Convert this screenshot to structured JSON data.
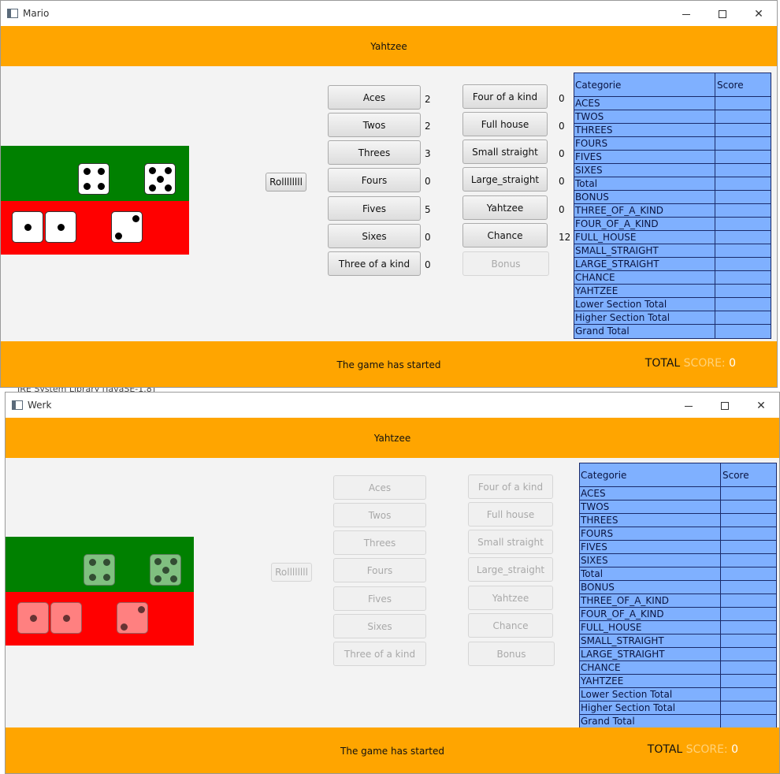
{
  "background": {
    "partial_text": "JRE System Library [JavaSE-1.8]"
  },
  "windows": [
    {
      "title": "Mario",
      "header": "Yahtzee",
      "roll_label": "Rollllllll",
      "status": "The game has started",
      "total_score": {
        "label_a": "TOTAL ",
        "label_b": "SCORE:",
        "value": " 0"
      },
      "left_buttons": [
        {
          "label": "Aces",
          "value": "2"
        },
        {
          "label": "Twos",
          "value": "2"
        },
        {
          "label": "Threes",
          "value": "3"
        },
        {
          "label": "Fours",
          "value": "0"
        },
        {
          "label": "Fives",
          "value": "5"
        },
        {
          "label": "Sixes",
          "value": "0"
        },
        {
          "label": "Three of a kind",
          "value": "0"
        }
      ],
      "right_buttons": [
        {
          "label": "Four of a kind",
          "value": "0"
        },
        {
          "label": "Full house",
          "value": "0"
        },
        {
          "label": "Small straight",
          "value": "0"
        },
        {
          "label": "Large_straight",
          "value": "0"
        },
        {
          "label": "Yahtzee",
          "value": "0"
        },
        {
          "label": "Chance",
          "value": "12"
        },
        {
          "label": "Bonus",
          "value": ""
        }
      ],
      "dice_green": [
        4,
        5
      ],
      "dice_red": [
        1,
        1,
        2
      ]
    },
    {
      "title": "Werk",
      "header": "Yahtzee",
      "roll_label": "Rollllllll",
      "status": "The game has started",
      "total_score": {
        "label_a": "TOTAL ",
        "label_b": "SCORE:",
        "value": " 0"
      },
      "left_buttons": [
        {
          "label": "Aces"
        },
        {
          "label": "Twos"
        },
        {
          "label": "Threes"
        },
        {
          "label": "Fours"
        },
        {
          "label": "Fives"
        },
        {
          "label": "Sixes"
        },
        {
          "label": "Three of a kind"
        }
      ],
      "right_buttons": [
        {
          "label": "Four of a kind"
        },
        {
          "label": "Full house"
        },
        {
          "label": "Small straight"
        },
        {
          "label": "Large_straight"
        },
        {
          "label": "Yahtzee"
        },
        {
          "label": "Chance"
        },
        {
          "label": "Bonus"
        }
      ],
      "dice_green": [
        4,
        5
      ],
      "dice_red": [
        1,
        1,
        2
      ]
    }
  ],
  "score_table": {
    "header_category": "Categorie",
    "header_score": "Score",
    "rows": [
      "ACES",
      "TWOS",
      "THREES",
      "FOURS",
      "FIVES",
      "SIXES",
      "Total",
      "BONUS",
      "THREE_OF_A_KIND",
      "FOUR_OF_A_KIND",
      "FULL_HOUSE",
      "SMALL_STRAIGHT",
      "LARGE_STRAIGHT",
      "CHANCE",
      "YAHTZEE",
      "Lower Section Total",
      "Higher Section Total",
      "Grand Total"
    ]
  },
  "colors": {
    "accent_orange": "#ffa500",
    "dice_green": "#008000",
    "dice_red": "#ff0000",
    "table_blue": "#7fb0ff"
  }
}
